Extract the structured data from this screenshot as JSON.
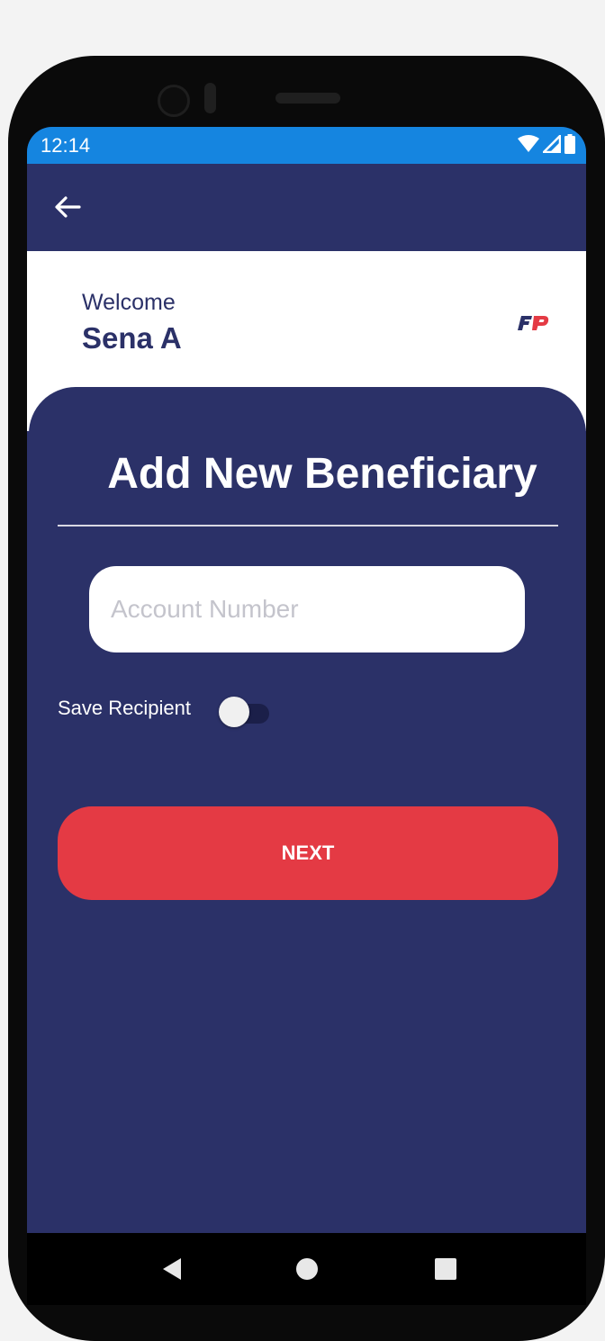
{
  "status_bar": {
    "time": "12:14",
    "color": "#1585e0"
  },
  "app_bar": {
    "back_icon": "arrow-left-icon"
  },
  "header": {
    "welcome_label": "Welcome",
    "user_name": "Sena A",
    "logo_icon": "fp-brand-logo"
  },
  "form": {
    "title": "Add New Beneficiary",
    "account_number_placeholder": "Account Number",
    "account_number_value": "",
    "save_recipient_label": "Save Recipient",
    "save_recipient_on": false,
    "next_label": "NEXT"
  },
  "colors": {
    "primary": "#2b3168",
    "accent": "#e43a44",
    "status_bar": "#1585e0",
    "surface": "#ffffff"
  },
  "nav": {
    "back_icon": "triangle-back-icon",
    "home_icon": "circle-home-icon",
    "recents_icon": "square-recents-icon"
  }
}
